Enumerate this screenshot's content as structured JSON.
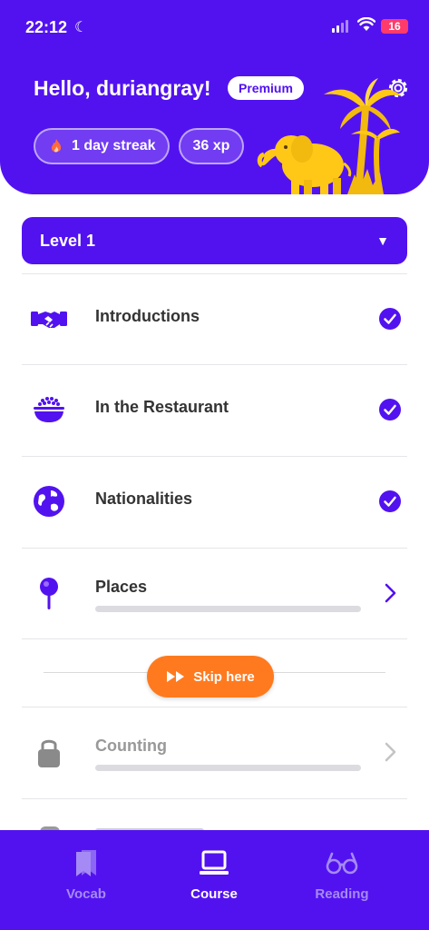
{
  "status": {
    "time": "22:12",
    "battery": "16"
  },
  "header": {
    "greeting": "Hello, duriangray!",
    "badge": "Premium",
    "streak": "1 day streak",
    "xp": "36 xp"
  },
  "level": {
    "label": "Level 1"
  },
  "lessons": [
    {
      "title": "Introductions",
      "icon": "handshake-icon",
      "state": "completed"
    },
    {
      "title": "In the Restaurant",
      "icon": "rice-bowl-icon",
      "state": "completed"
    },
    {
      "title": "Nationalities",
      "icon": "globe-icon",
      "state": "completed"
    },
    {
      "title": "Places",
      "icon": "map-pin-icon",
      "state": "available",
      "progress": 0
    },
    {
      "title": "Counting",
      "icon": "lock-icon",
      "state": "locked",
      "progress": 0
    }
  ],
  "skip": {
    "label": "Skip here"
  },
  "tabs": [
    {
      "label": "Vocab",
      "icon": "bookmark-icon",
      "active": false
    },
    {
      "label": "Course",
      "icon": "laptop-icon",
      "active": true
    },
    {
      "label": "Reading",
      "icon": "glasses-icon",
      "active": false
    }
  ],
  "colors": {
    "brand": "#5212f0",
    "accent": "#ff7a1e",
    "battery": "#ff3b6b"
  }
}
